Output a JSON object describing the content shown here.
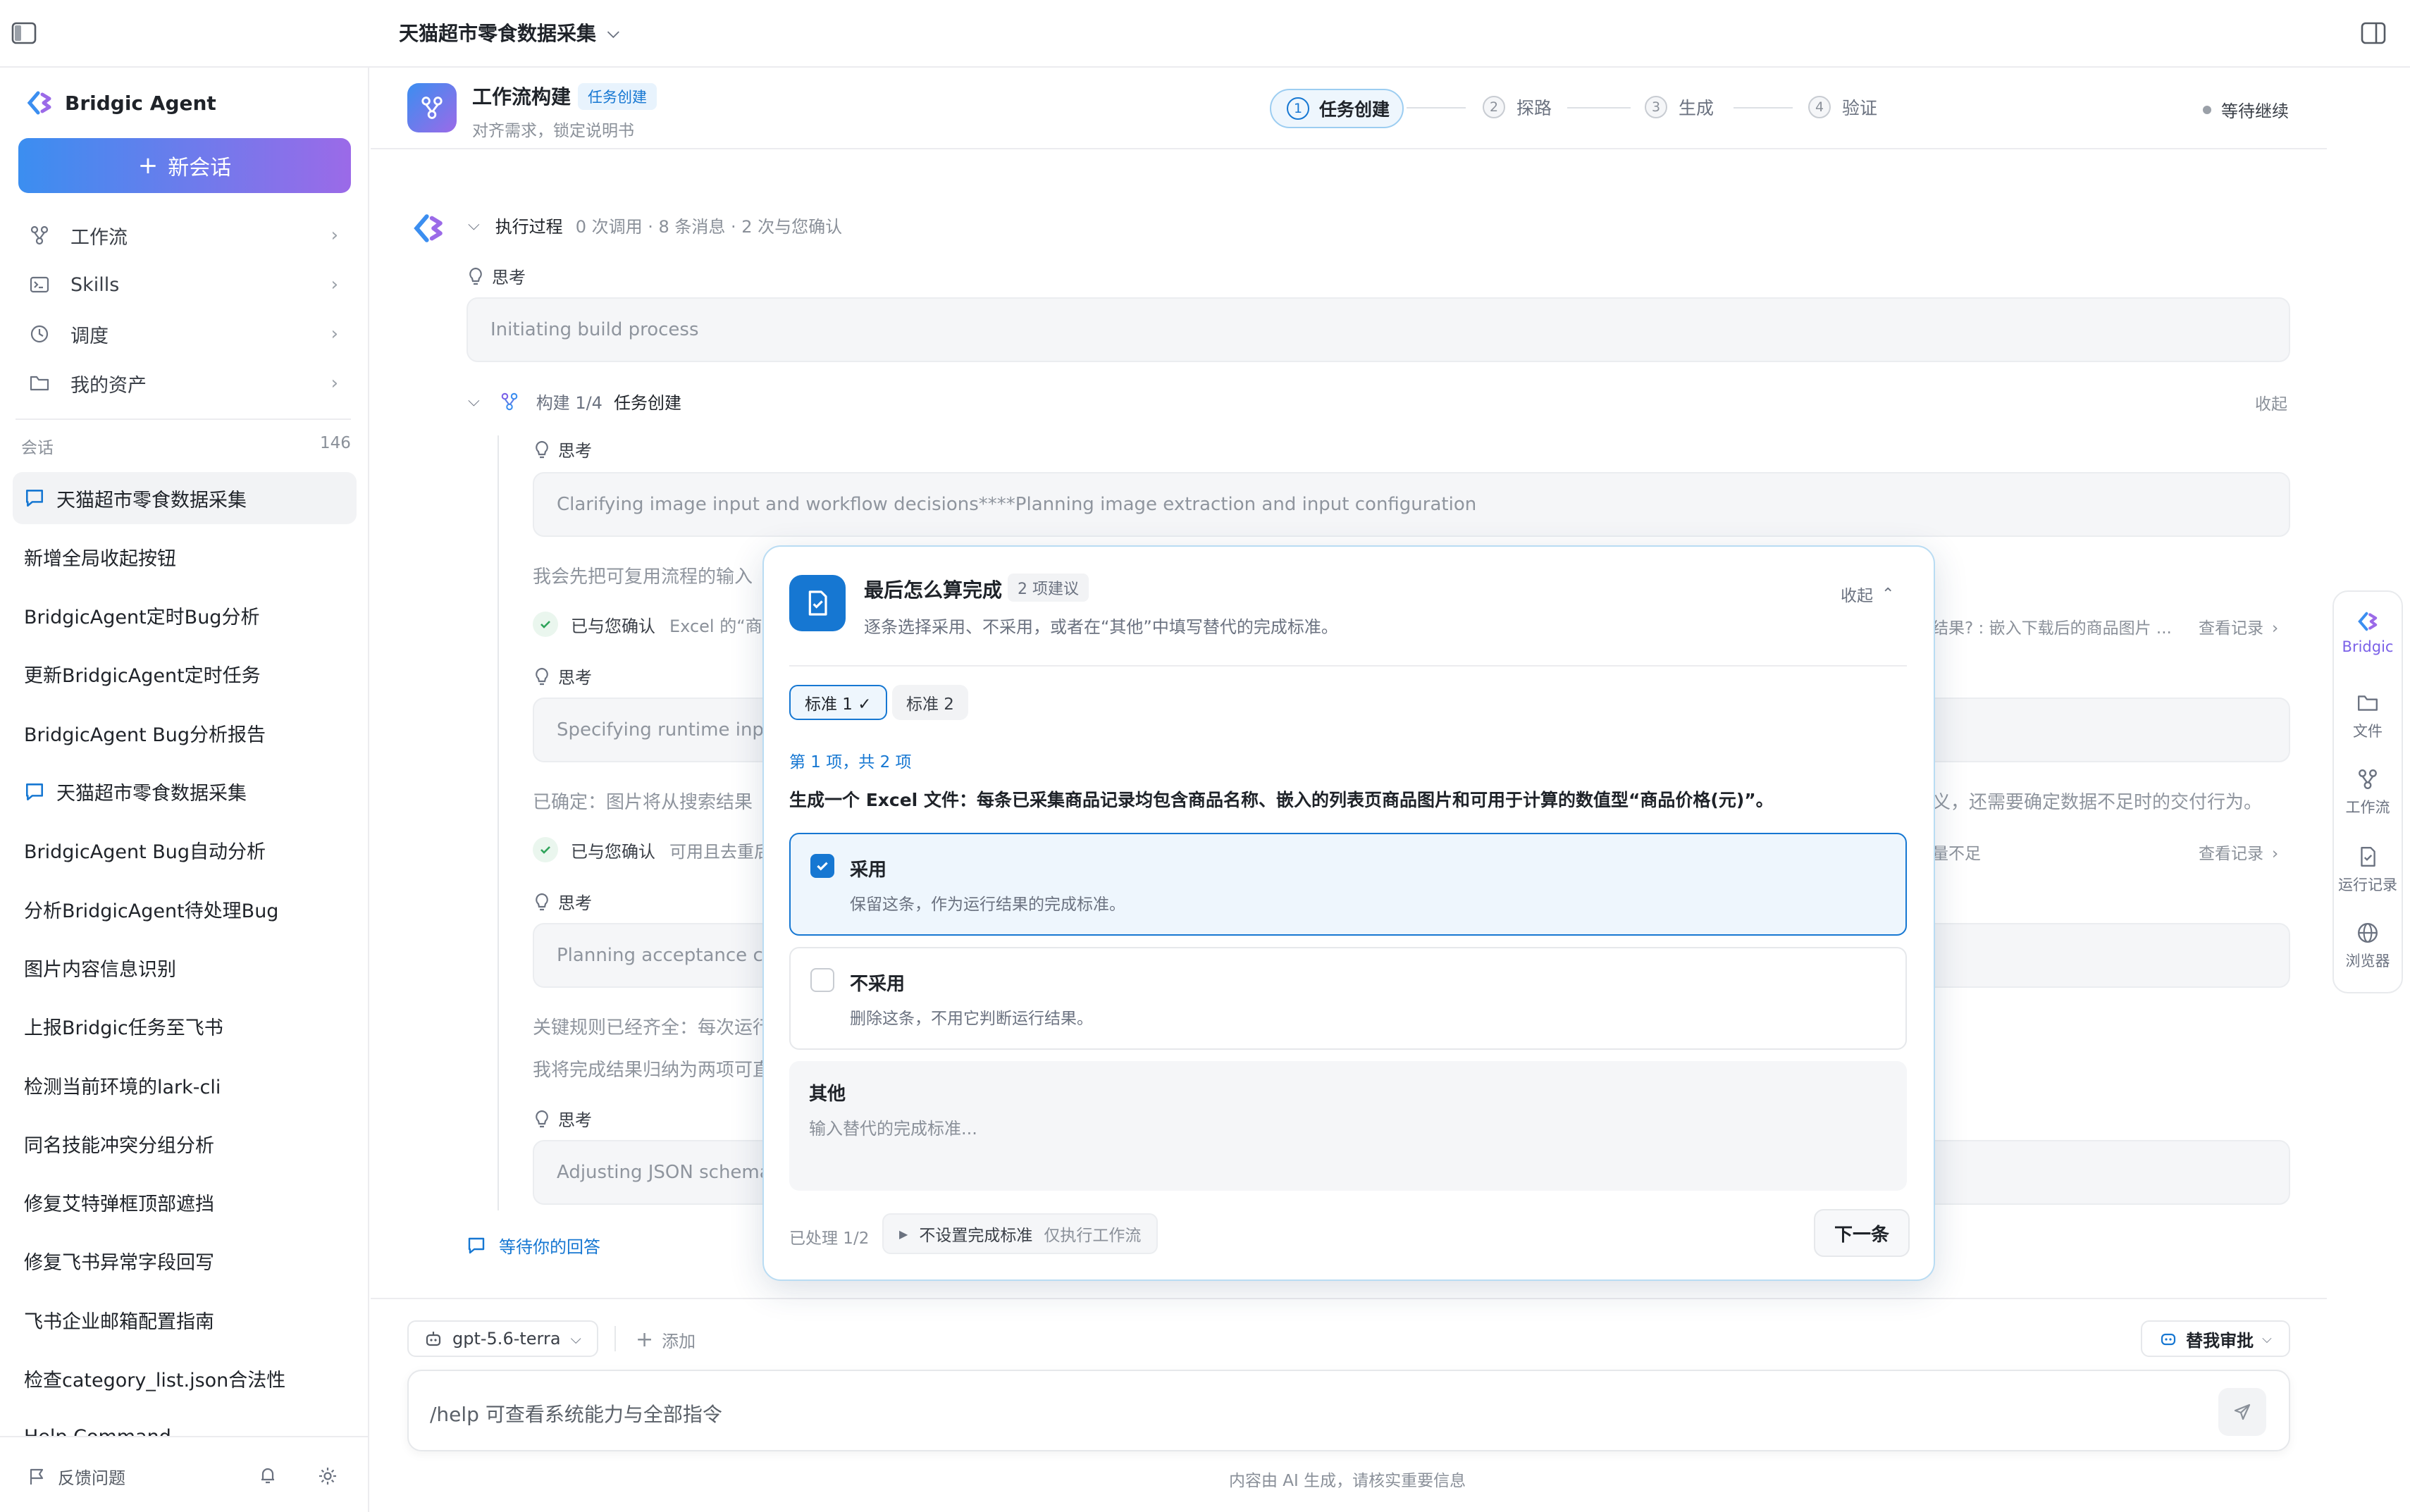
{
  "header": {
    "title": "天猫超市零食数据采集"
  },
  "sidebar": {
    "brand": "Bridgic Agent",
    "new_chat": "新会话",
    "nav": [
      {
        "label": "工作流",
        "icon": "workflow-icon"
      },
      {
        "label": "Skills",
        "icon": "terminal-icon"
      },
      {
        "label": "调度",
        "icon": "clock-icon"
      },
      {
        "label": "我的资产",
        "icon": "folder-icon"
      }
    ],
    "section_label": "会话",
    "section_count": "146",
    "conversations": [
      "天猫超市零食数据采集",
      "新增全局收起按钮",
      "BridgicAgent定时Bug分析",
      "更新BridgicAgent定时任务",
      "BridgicAgent Bug分析报告",
      "天猫超市零食数据采集",
      "BridgicAgent Bug自动分析",
      "分析BridgicAgent待处理Bug",
      "图片内容信息识别",
      "上报Bridgic任务至飞书",
      "检测当前环境的lark-cli",
      "同名技能冲突分组分析",
      "修复艾特弹框顶部遮挡",
      "修复飞书异常字段回写",
      "飞书企业邮箱配置指南",
      "检查category_list.json合法性",
      "Help Command"
    ],
    "feedback": "反馈问题"
  },
  "workflow": {
    "title": "工作流构建",
    "badge": "任务创建",
    "subtitle": "对齐需求，锁定说明书",
    "steps": [
      {
        "num": "1",
        "label": "任务创建"
      },
      {
        "num": "2",
        "label": "探路"
      },
      {
        "num": "3",
        "label": "生成"
      },
      {
        "num": "4",
        "label": "验证"
      }
    ],
    "status": "等待继续"
  },
  "process": {
    "label": "执行过程",
    "meta": "0 次调用 · 8 条消息 · 2 次与您确认",
    "think_label": "思考",
    "think1": "Initiating build process",
    "build_label": "构建 1/4",
    "build_stage": "任务创建",
    "collapse": "收起",
    "think2": "Clarifying image input and workflow decisions****Planning image extraction and input configuration",
    "para1": "我会先把可复用流程的输入",
    "confirmed_label": "已与您确认",
    "confirm1_detail": "Excel 的“商品",
    "confirm1_right": "结果? : 嵌入下载后的商品图片 ...",
    "view_record": "查看记录",
    "think3": "Specifying runtime inpu",
    "para2": "已确定：图片将从搜索结果",
    "para2_right": "义，还需要确定数据不足时的交付行为。",
    "confirm2_detail": "可用且去重后",
    "confirm2_right": "量不足",
    "think4": "Planning acceptance cr",
    "para3": "关键规则已经齐全：每次运行",
    "para4": "我将完成结果归纳为两项可直",
    "think5": "Adjusting JSON schema",
    "waiting": "等待你的回答"
  },
  "modal": {
    "title": "最后怎么算完成",
    "badge": "2 项建议",
    "subtitle": "逐条选择采用、不采用，或者在“其他”中填写替代的完成标准。",
    "collapse": "收起",
    "tabs": [
      "标准 1 ✓",
      "标准 2"
    ],
    "progress": "第 1 项，共 2 项",
    "question": "生成一个 Excel 文件：每条已采集商品记录均包含商品名称、嵌入的列表页商品图片和可用于计算的数值型“商品价格(元)”。",
    "options": [
      {
        "title": "采用",
        "desc": "保留这条，作为运行结果的完成标准。",
        "checked": true
      },
      {
        "title": "不采用",
        "desc": "删除这条，不用它判断运行结果。",
        "checked": false
      }
    ],
    "other_title": "其他",
    "other_placeholder": "输入替代的完成标准...",
    "processed": "已处理 1/2",
    "skip_label": "不设置完成标准",
    "skip_hint": "仅执行工作流",
    "next": "下一条"
  },
  "rail": {
    "brand": "Bridgic",
    "items": [
      "文件",
      "工作流",
      "运行记录",
      "浏览器"
    ]
  },
  "composer": {
    "model": "gpt-5.6-terra",
    "add": "添加",
    "approve": "替我审批",
    "placeholder": "/help 可查看系统能力与全部指令",
    "disclaimer": "内容由 AI 生成，请核实重要信息"
  },
  "colors": {
    "accent": "#1677d2",
    "brand_gradient_start": "#3b8ef0",
    "brand_gradient_end": "#9b6ae8",
    "success": "#2fa35a"
  }
}
